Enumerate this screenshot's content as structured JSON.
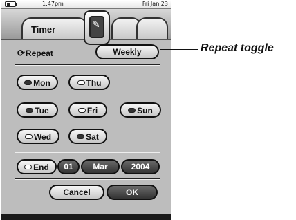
{
  "status_bar": {
    "time": "1:47pm",
    "date": "Fri Jan 23"
  },
  "tabs": {
    "active_label": "Timer"
  },
  "repeat": {
    "label": "Repeat",
    "icon": "repeat-arrows-icon",
    "mode_button": "Weekly"
  },
  "days": [
    {
      "label": "Mon",
      "selected": true
    },
    {
      "label": "Thu",
      "selected": false
    },
    {
      "label": "Tue",
      "selected": true
    },
    {
      "label": "Fri",
      "selected": false
    },
    {
      "label": "Sun",
      "selected": true
    },
    {
      "label": "Wed",
      "selected": false
    },
    {
      "label": "Sat",
      "selected": true
    }
  ],
  "end": {
    "label": "End",
    "selected": false,
    "day": "01",
    "month": "Mar",
    "year": "2004"
  },
  "actions": {
    "cancel": "Cancel",
    "ok": "OK"
  },
  "annotation": "Repeat toggle"
}
